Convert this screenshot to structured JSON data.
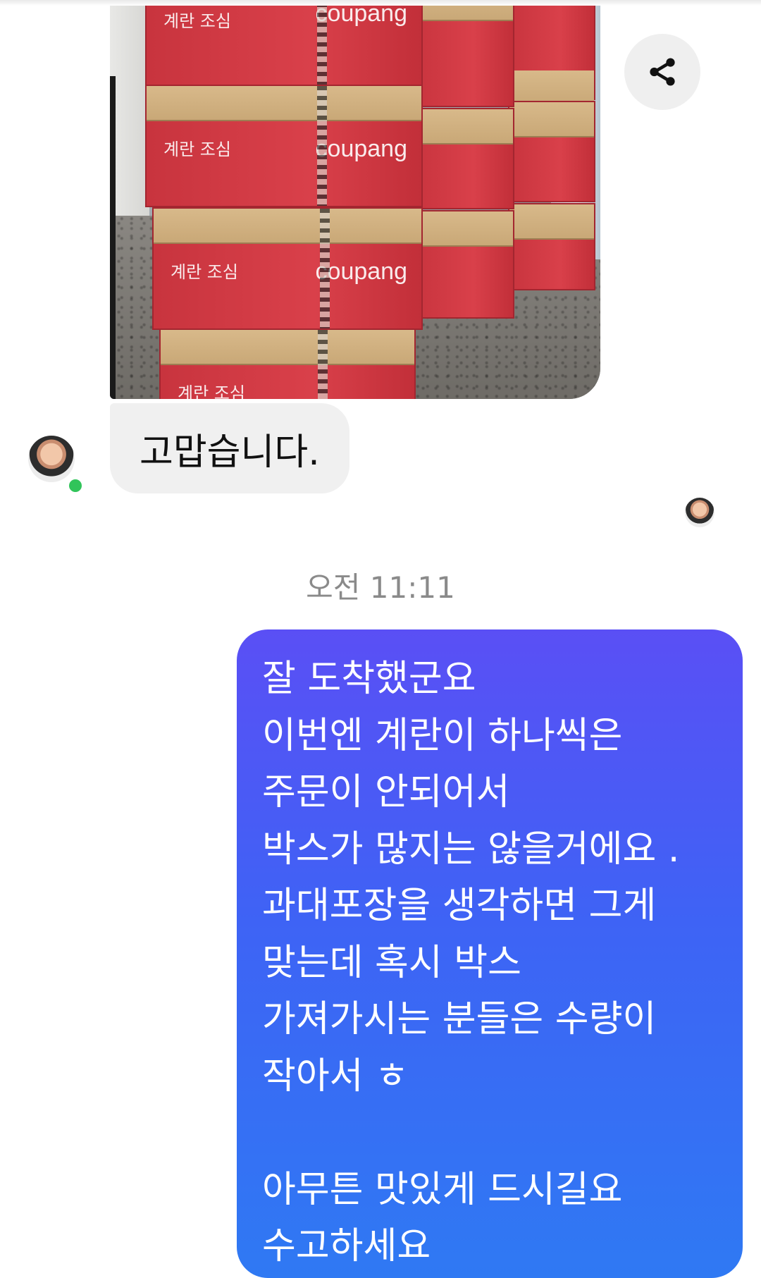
{
  "photo": {
    "description_icon": "image-photo",
    "box_brand": "coupang",
    "box_label": "계란 조심"
  },
  "share_button": {
    "icon": "share-icon"
  },
  "received_message": {
    "text": "고맙습니다."
  },
  "timestamp": "오전 11:11",
  "sent_message": {
    "text": "잘 도착했군요\n이번엔 계란이 하나씩은\n주문이 안되어서\n박스가 많지는 않을거에요 .\n과대포장을 생각하면 그게\n맞는데 혹시 박스\n가져가시는 분들은 수량이\n작아서 ㅎ\n\n아무튼 맛있게 드시길요\n수고하세요"
  },
  "colors": {
    "received_bubble": "#f0f0f0",
    "sent_gradient_top": "#5a4ff5",
    "sent_gradient_bottom": "#2f79f3",
    "online_status": "#31c45a"
  }
}
